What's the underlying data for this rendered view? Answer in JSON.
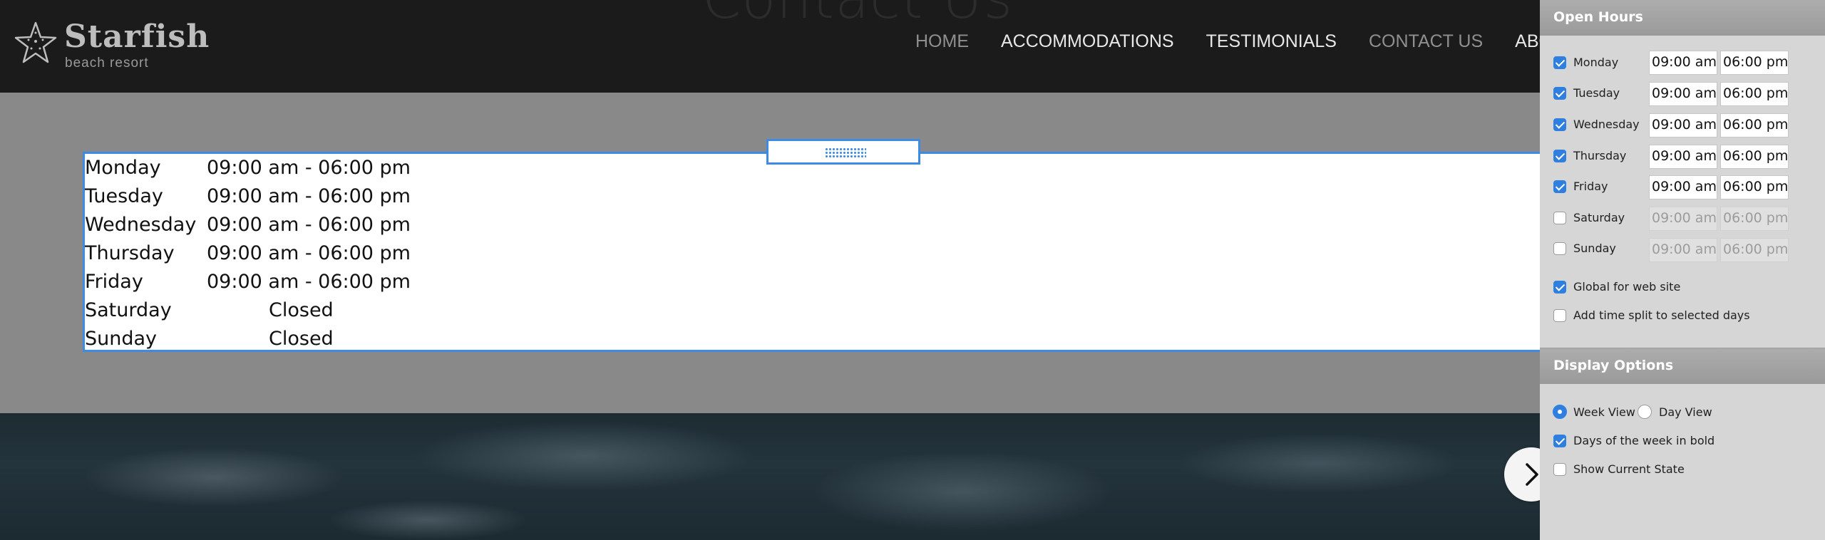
{
  "site": {
    "logo_name": "Starfish",
    "logo_sub": "beach resort",
    "background_heading": "Contact Us",
    "nav": [
      {
        "label": "HOME",
        "muted": true
      },
      {
        "label": "ACCOMMODATIONS",
        "muted": false
      },
      {
        "label": "TESTIMONIALS",
        "muted": false
      },
      {
        "label": "CONTACT US",
        "muted": true
      },
      {
        "label": "ABOUT US",
        "muted": false
      }
    ]
  },
  "hours_widget": {
    "rows": [
      {
        "day": "Monday",
        "hours": "09:00 am - 06:00 pm"
      },
      {
        "day": "Tuesday",
        "hours": "09:00 am - 06:00 pm"
      },
      {
        "day": "Wednesday",
        "hours": "09:00 am - 06:00 pm"
      },
      {
        "day": "Thursday",
        "hours": "09:00 am - 06:00 pm"
      },
      {
        "day": "Friday",
        "hours": "09:00 am - 06:00 pm"
      },
      {
        "day": "Saturday",
        "hours": "Closed"
      },
      {
        "day": "Sunday",
        "hours": "Closed"
      }
    ]
  },
  "settings": {
    "open_hours_title": "Open Hours",
    "days": [
      {
        "label": "Monday",
        "checked": true,
        "open": "09:00 am",
        "close": "06:00 pm"
      },
      {
        "label": "Tuesday",
        "checked": true,
        "open": "09:00 am",
        "close": "06:00 pm"
      },
      {
        "label": "Wednesday",
        "checked": true,
        "open": "09:00 am",
        "close": "06:00 pm"
      },
      {
        "label": "Thursday",
        "checked": true,
        "open": "09:00 am",
        "close": "06:00 pm"
      },
      {
        "label": "Friday",
        "checked": true,
        "open": "09:00 am",
        "close": "06:00 pm"
      },
      {
        "label": "Saturday",
        "checked": false,
        "open": "09:00 am",
        "close": "06:00 pm"
      },
      {
        "label": "Sunday",
        "checked": false,
        "open": "09:00 am",
        "close": "06:00 pm"
      }
    ],
    "global_label": "Global for web site",
    "global_checked": true,
    "time_split_label": "Add time split to selected days",
    "time_split_checked": false,
    "display_options_title": "Display Options",
    "week_view_label": "Week View",
    "day_view_label": "Day View",
    "selected_view": "week",
    "bold_days_label": "Days of the week in bold",
    "bold_days_checked": true,
    "show_state_label": "Show Current State",
    "show_state_checked": false
  },
  "colors": {
    "accent": "#3d8be3",
    "checkbox_on": "#2f7fe0",
    "header_bg": "#1b1b1b",
    "panel_bg": "#d6d6d6"
  }
}
